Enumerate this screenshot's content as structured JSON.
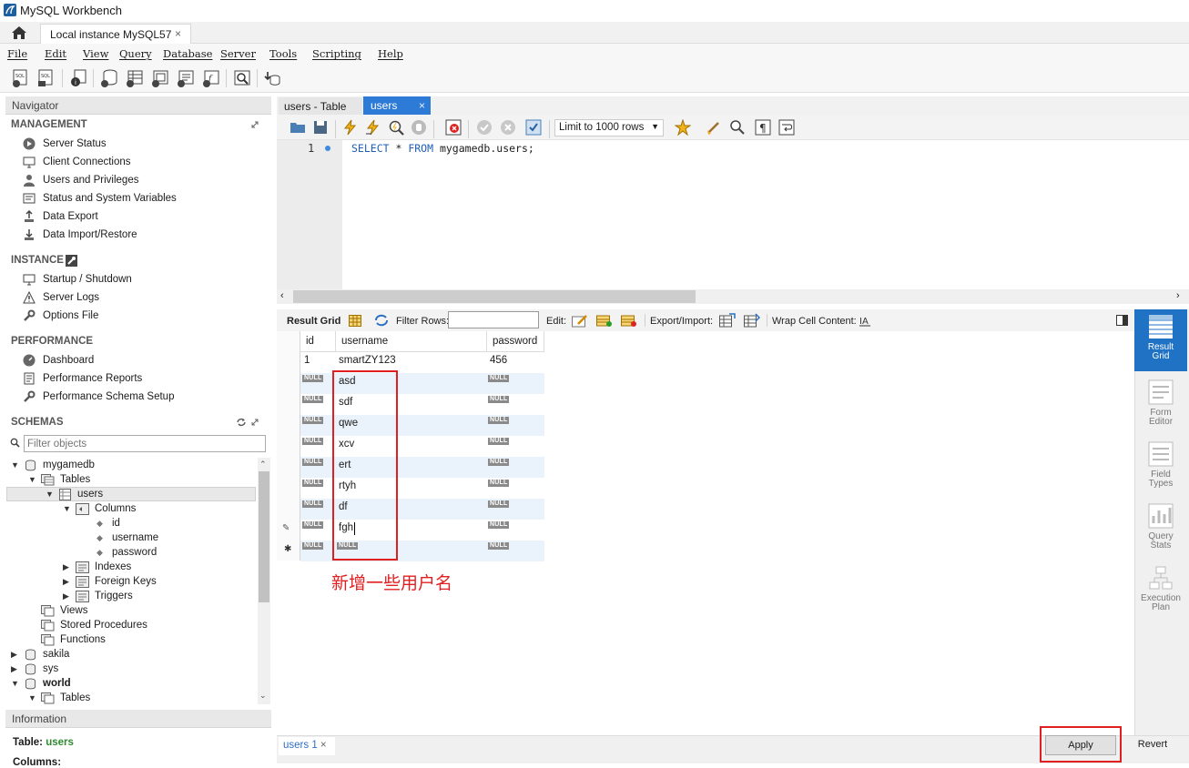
{
  "window": {
    "title": "MySQL Workbench"
  },
  "connection_tab": {
    "label": "Local instance MySQL57",
    "close": "×"
  },
  "menu": [
    "File",
    "Edit",
    "View",
    "Query",
    "Database",
    "Server",
    "Tools",
    "Scripting",
    "Help"
  ],
  "navigator": {
    "title": "Navigator",
    "management": {
      "title": "MANAGEMENT",
      "items": [
        "Server Status",
        "Client Connections",
        "Users and Privileges",
        "Status and System Variables",
        "Data Export",
        "Data Import/Restore"
      ]
    },
    "instance": {
      "title": "INSTANCE",
      "items": [
        "Startup / Shutdown",
        "Server Logs",
        "Options File"
      ]
    },
    "performance": {
      "title": "PERFORMANCE",
      "items": [
        "Dashboard",
        "Performance Reports",
        "Performance Schema Setup"
      ]
    },
    "schemas": {
      "title": "SCHEMAS",
      "filter_placeholder": "Filter objects",
      "tree": {
        "mygamedb": "mygamedb",
        "tables": "Tables",
        "users": "users",
        "columns": "Columns",
        "col_id": "id",
        "col_username": "username",
        "col_password": "password",
        "indexes": "Indexes",
        "foreign_keys": "Foreign Keys",
        "triggers": "Triggers",
        "views": "Views",
        "stored_procedures": "Stored Procedures",
        "functions": "Functions",
        "sakila": "sakila",
        "sys": "sys",
        "world": "world",
        "world_tables": "Tables"
      }
    }
  },
  "information": {
    "title": "Information",
    "table_label": "Table:",
    "table_name": "users",
    "columns_label": "Columns:"
  },
  "editor_tabs": [
    {
      "label": "users - Table"
    },
    {
      "label": "users",
      "close": "×"
    }
  ],
  "sql_toolbar": {
    "limit": "Limit to 1000 rows"
  },
  "editor": {
    "line_number": "1",
    "sql_kw1": "SELECT",
    "sql_mid": " * ",
    "sql_kw2": "FROM",
    "sql_rest": " mygamedb.users;"
  },
  "result_toolbar": {
    "result_grid": "Result Grid",
    "filter_rows": "Filter Rows:",
    "edit": "Edit:",
    "export_import": "Export/Import:",
    "wrap": "Wrap Cell Content:"
  },
  "grid": {
    "columns": [
      "id",
      "username",
      "password"
    ],
    "null_label": "NULL",
    "rows": [
      {
        "id": "1",
        "username": "smartZY123",
        "password": "456"
      },
      {
        "id": "NULL",
        "username": "asd",
        "password": "NULL"
      },
      {
        "id": "NULL",
        "username": "sdf",
        "password": "NULL"
      },
      {
        "id": "NULL",
        "username": "qwe",
        "password": "NULL"
      },
      {
        "id": "NULL",
        "username": "xcv",
        "password": "NULL"
      },
      {
        "id": "NULL",
        "username": "ert",
        "password": "NULL"
      },
      {
        "id": "NULL",
        "username": "rtyh",
        "password": "NULL"
      },
      {
        "id": "NULL",
        "username": "df",
        "password": "NULL"
      },
      {
        "id": "NULL",
        "username": "fgh",
        "password": "NULL"
      },
      {
        "id": "NULL",
        "username": "NULL",
        "password": "NULL"
      }
    ]
  },
  "annotation": "新增一些用户名",
  "side_panel": [
    {
      "label_1": "Result",
      "label_2": "Grid"
    },
    {
      "label_1": "Form",
      "label_2": "Editor"
    },
    {
      "label_1": "Field",
      "label_2": "Types"
    },
    {
      "label_1": "Query",
      "label_2": "Stats"
    },
    {
      "label_1": "Execution",
      "label_2": "Plan"
    }
  ],
  "bottom": {
    "tab": "users 1",
    "tab_close": "×",
    "apply": "Apply",
    "revert": "Revert"
  },
  "colors": {
    "accent": "#2d7bd6",
    "annotation": "#e02020"
  }
}
